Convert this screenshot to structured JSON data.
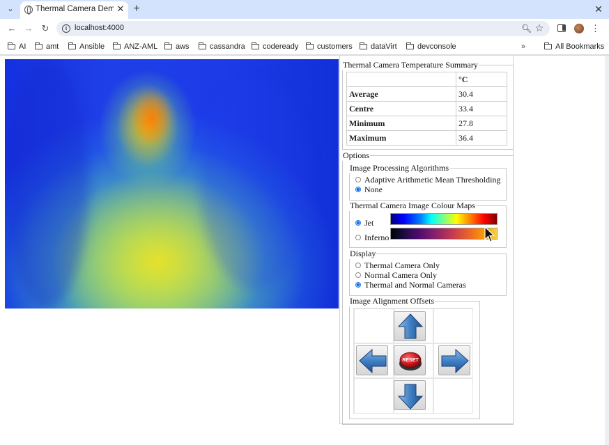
{
  "browser": {
    "tab_title": "Thermal Camera Demon",
    "url": "localhost:4000",
    "bookmarks": [
      "AI",
      "amt",
      "Ansible",
      "ANZ-AML",
      "aws",
      "cassandra",
      "codeready",
      "customers",
      "dataVirt",
      "devconsole"
    ],
    "bookmarks_more": "»",
    "all_bookmarks": "All Bookmarks"
  },
  "summary": {
    "legend": "Thermal Camera Temperature Summary",
    "unit_header": "°C",
    "rows": [
      {
        "label": "Average",
        "value": "30.4"
      },
      {
        "label": "Centre",
        "value": "33.4"
      },
      {
        "label": "Minimum",
        "value": "27.8"
      },
      {
        "label": "Maximum",
        "value": "36.4"
      }
    ]
  },
  "options": {
    "legend": "Options",
    "processing": {
      "legend": "Image Processing Algorithms",
      "items": [
        {
          "label": "Adaptive Arithmetic Mean Thresholding",
          "selected": false
        },
        {
          "label": "None",
          "selected": true
        }
      ]
    },
    "colour_maps": {
      "legend": "Thermal Camera Image Colour Maps",
      "items": [
        {
          "label": "Jet",
          "selected": true
        },
        {
          "label": "Inferno",
          "selected": false
        }
      ]
    },
    "display": {
      "legend": "Display",
      "items": [
        {
          "label": "Thermal Camera Only",
          "selected": false
        },
        {
          "label": "Normal Camera Only",
          "selected": false
        },
        {
          "label": "Thermal and Normal Cameras",
          "selected": true
        }
      ]
    },
    "alignment": {
      "legend": "Image Alignment Offsets",
      "reset_label": "RESET"
    }
  },
  "colors": {
    "accent": "#1a73e8",
    "arrow_blue": "#3f7fc4",
    "reset_red": "#c8161d"
  }
}
